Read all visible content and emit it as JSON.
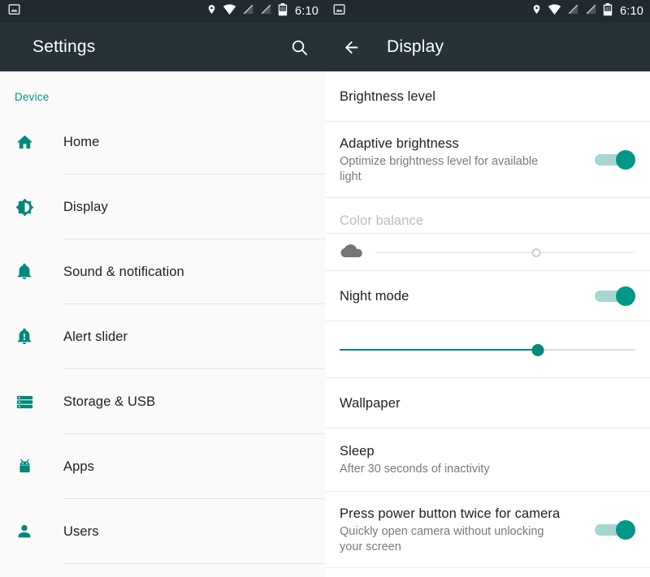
{
  "status_bar": {
    "left_icons": [
      {
        "name": "screenshot-icon",
        "glyph": "image"
      }
    ],
    "right_icons": [
      {
        "name": "location-icon",
        "glyph": "pin"
      },
      {
        "name": "wifi-icon",
        "glyph": "wifi"
      },
      {
        "name": "signal-off-icon-1",
        "glyph": "signal-slash"
      },
      {
        "name": "signal-off-icon-2",
        "glyph": "signal-slash"
      },
      {
        "name": "battery-icon",
        "glyph": "battery",
        "level_text": "83"
      }
    ],
    "time": "6:10"
  },
  "left_pane": {
    "appbar": {
      "title": "Settings",
      "search_icon": "search-icon"
    },
    "section_label": "Device",
    "items": [
      {
        "label": "Home",
        "icon": "home-icon"
      },
      {
        "label": "Display",
        "icon": "brightness-icon"
      },
      {
        "label": "Sound & notification",
        "icon": "bell-icon"
      },
      {
        "label": "Alert slider",
        "icon": "bell-alert-icon"
      },
      {
        "label": "Storage & USB",
        "icon": "storage-icon"
      },
      {
        "label": "Apps",
        "icon": "android-icon"
      },
      {
        "label": "Users",
        "icon": "person-icon"
      }
    ]
  },
  "right_pane": {
    "appbar": {
      "title": "Display",
      "back_icon": "back-arrow-icon"
    },
    "rows": [
      {
        "type": "plain",
        "name": "brightness-level",
        "title": "Brightness level"
      },
      {
        "type": "switch",
        "name": "adaptive-brightness",
        "title": "Adaptive brightness",
        "subtitle": "Optimize brightness level for available light",
        "switch_on": true
      },
      {
        "type": "slider",
        "name": "color-balance",
        "title": "Color balance",
        "disabled": true,
        "leading_icon": "cloud-icon",
        "value_percent": 62
      },
      {
        "type": "switch",
        "name": "night-mode",
        "title": "Night mode",
        "switch_on": true
      },
      {
        "type": "slider-only",
        "name": "night-mode-intensity",
        "value_percent": 67
      },
      {
        "type": "plain",
        "name": "wallpaper",
        "title": "Wallpaper"
      },
      {
        "type": "plain-sub",
        "name": "sleep",
        "title": "Sleep",
        "subtitle": "After 30 seconds of inactivity"
      },
      {
        "type": "switch",
        "name": "press-power-twice-camera",
        "title": "Press power button twice for camera",
        "subtitle": "Quickly open camera without unlocking your screen",
        "switch_on": true
      }
    ]
  },
  "colors": {
    "accent": "#009688",
    "appbar": "#263238",
    "statusbar": "#212a30",
    "slider_fill": "#00897b",
    "text_primary": "#212121",
    "text_secondary": "#7a7a7a",
    "text_disabled": "#bdbdbd"
  }
}
